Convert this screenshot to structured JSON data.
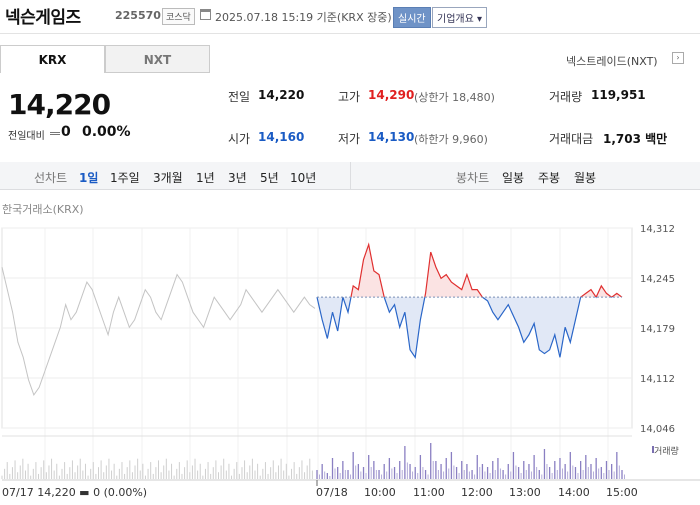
{
  "header": {
    "stock_name": "넥슨게임즈",
    "stock_code": "225570",
    "market": "코스닥",
    "datetime": "2025.07.18 15:19 기준(KRX 장중)",
    "realtime": "실시간",
    "company": "기업개요 ▾"
  },
  "tabs": {
    "krx": "KRX",
    "nxt": "NXT",
    "nextrade": "넥스트레이드(NXT)"
  },
  "price": {
    "current": "14,220",
    "change_label": "전일대비",
    "change": "0",
    "change_pct": "0.00%"
  },
  "stats": {
    "prev_label": "전일",
    "prev": "14,220",
    "high_label": "고가",
    "high": "14,290",
    "upper_limit": "(상한가 18,480)",
    "volume_label": "거래량",
    "volume": "119,951",
    "open_label": "시가",
    "open": "14,160",
    "low_label": "저가",
    "low": "14,130",
    "lower_limit": "(하한가 9,960)",
    "amount_label": "거래대금",
    "amount": "1,703 백만"
  },
  "periods": {
    "line_label": "선차트",
    "items": [
      "1일",
      "1주일",
      "3개월",
      "1년",
      "3년",
      "5년",
      "10년"
    ],
    "active": "1일",
    "candle_label": "봉차트",
    "candle_items": [
      "일봉",
      "주봉",
      "월봉"
    ]
  },
  "chart_data": {
    "type": "line",
    "title": "한국거래소(KRX)",
    "baseline": 14220,
    "ylim": [
      14046,
      14312
    ],
    "y_ticks": [
      "14,312",
      "14,245",
      "14,179",
      "14,112",
      "14,046"
    ],
    "x_ticks": [
      "07/18",
      "10:00",
      "11:00",
      "12:00",
      "13:00",
      "14:00",
      "15:00"
    ],
    "prev_day_label": "07/17 14,220 ▬ 0 (0.00%)",
    "volume_label": "거래량",
    "series": [
      {
        "name": "prev",
        "values": [
          14260,
          14230,
          14200,
          14160,
          14140,
          14110,
          14090,
          14100,
          14120,
          14140,
          14160,
          14180,
          14210,
          14190,
          14200,
          14220,
          14240,
          14230,
          14210,
          14190,
          14170,
          14200,
          14220,
          14200,
          14180,
          14190,
          14210,
          14230,
          14220,
          14200,
          14190,
          14210,
          14230,
          14250,
          14240,
          14220,
          14200,
          14190,
          14180,
          14200,
          14220,
          14210,
          14200,
          14190,
          14200,
          14210,
          14230,
          14220,
          14210,
          14200,
          14210,
          14220,
          14230,
          14220,
          14210,
          14200,
          14210,
          14220,
          14210,
          14205
        ]
      },
      {
        "name": "today",
        "values": [
          14220,
          14190,
          14165,
          14200,
          14175,
          14220,
          14200,
          14235,
          14230,
          14270,
          14290,
          14255,
          14250,
          14220,
          14200,
          14210,
          14180,
          14200,
          14150,
          14140,
          14190,
          14225,
          14280,
          14260,
          14245,
          14250,
          14240,
          14235,
          14230,
          14250,
          14230,
          14230,
          14220,
          14215,
          14200,
          14190,
          14200,
          14210,
          14195,
          14180,
          14160,
          14170,
          14185,
          14150,
          14145,
          14150,
          14170,
          14140,
          14180,
          14160,
          14190,
          14220,
          14225,
          14230,
          14220,
          14235,
          14225,
          14220,
          14225,
          14220
        ]
      }
    ],
    "volume": [
      3,
      5,
      2,
      7,
      4,
      6,
      3,
      9,
      5,
      4,
      8,
      6,
      3,
      5,
      7,
      4,
      6,
      11,
      5,
      4,
      8,
      3,
      12,
      6,
      5,
      7,
      9,
      4,
      6,
      5,
      3,
      8,
      5,
      4,
      6,
      7,
      3,
      5,
      9,
      4,
      6,
      5,
      8,
      3,
      10,
      4,
      6,
      7,
      5,
      9,
      4,
      6,
      8,
      5,
      7,
      4,
      6,
      5,
      9,
      3
    ]
  }
}
